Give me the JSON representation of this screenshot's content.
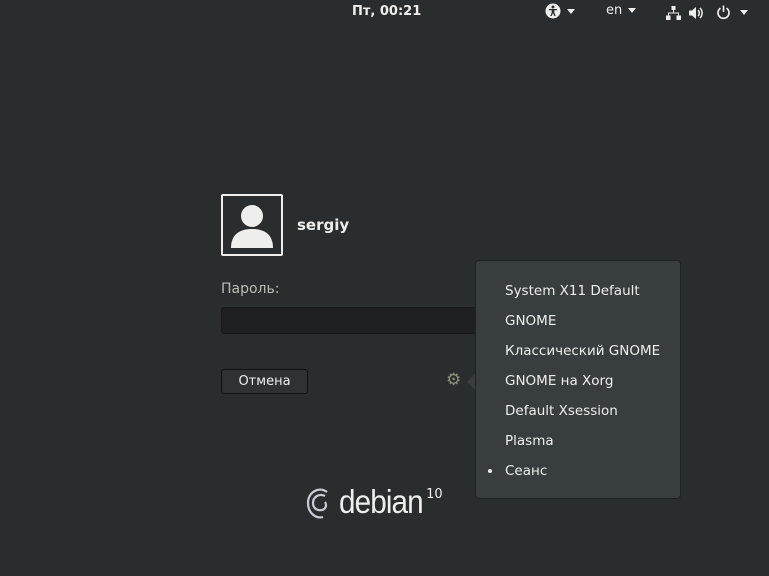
{
  "topbar": {
    "clock": "Пт, 00:21",
    "language": "en",
    "icons": [
      "accessibility-icon",
      "network-icon",
      "volume-icon",
      "power-icon"
    ]
  },
  "login": {
    "username": "sergiy",
    "password_label": "Пароль:",
    "password_value": "",
    "cancel_label": "Отмена"
  },
  "session_menu": {
    "items": [
      {
        "label": "System X11 Default",
        "selected": false
      },
      {
        "label": "GNOME",
        "selected": false
      },
      {
        "label": "Классический GNOME",
        "selected": false
      },
      {
        "label": "GNOME на Xorg",
        "selected": false
      },
      {
        "label": "Default Xsession",
        "selected": false
      },
      {
        "label": "Plasma",
        "selected": false
      },
      {
        "label": "Сеанс",
        "selected": true
      }
    ]
  },
  "branding": {
    "logo_text": "debian",
    "version": "10"
  }
}
